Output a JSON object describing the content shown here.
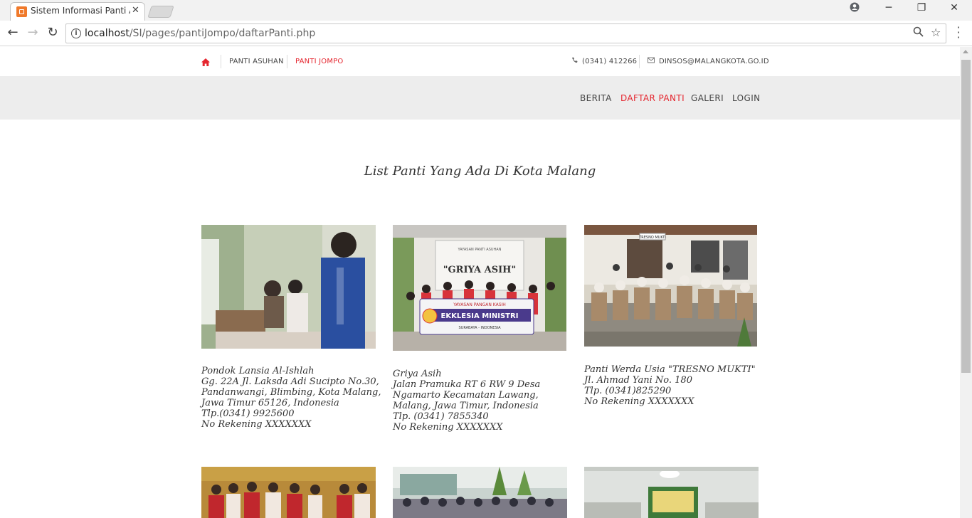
{
  "browser": {
    "tab_title": "Sistem Informasi Panti As",
    "url_host": "localhost",
    "url_path": "/SI/pages/pantiJompo/daftarPanti.php",
    "window_controls": [
      "account-icon",
      "minimize-icon",
      "restore-icon",
      "close-icon"
    ]
  },
  "topbar": {
    "links": [
      "PANTI ASUHAN",
      "PANTI JOMPO"
    ],
    "active_link": "PANTI JOMPO",
    "phone": "(0341) 412266",
    "email": "DINSOS@MALANGKOTA.GO.ID"
  },
  "nav": {
    "items": [
      "BERITA",
      "DAFTAR PANTI",
      "GALERI",
      "LOGIN"
    ],
    "active": "DAFTAR PANTI"
  },
  "heading": "List Panti Yang Ada Di Kota Malang",
  "cards": [
    {
      "lines": [
        "Pondok Lansia Al-Ishlah",
        "Gg. 22A Jl. Laksda Adi Sucipto No.30,",
        "Pandanwangi, Blimbing, Kota Malang,",
        "Jawa Timur 65126, Indonesia",
        "Tlp.(0341) 9925600",
        "No Rekening XXXXXXX"
      ]
    },
    {
      "lines": [
        "Griya Asih",
        "Jalan Pramuka RT 6 RW 9 Desa",
        "Ngamarto Kecamatan Lawang,",
        "Malang, Jawa Timur, Indonesia",
        "Tlp. (0341) 7855340",
        "No Rekening XXXXXXX"
      ],
      "banner": [
        "YAYASAN PANTI ASUHAN",
        "\"GRIYA ASIH\"",
        "YAYASAN PANGAN KASIH",
        "EKKLESIA MINISTRI",
        "SURABAYA - INDONESIA"
      ]
    },
    {
      "lines": [
        "Panti Werda Usia \"TRESNO MUKTI\"",
        "Jl. Ahmad Yani No. 180",
        "Tlp. (0341)825290",
        "No Rekening XXXXXXX"
      ],
      "sign": "TRESNO MUKTI"
    }
  ],
  "colors": {
    "accent": "#e5262f",
    "navbar_bg": "#ededed",
    "text": "#333333"
  }
}
